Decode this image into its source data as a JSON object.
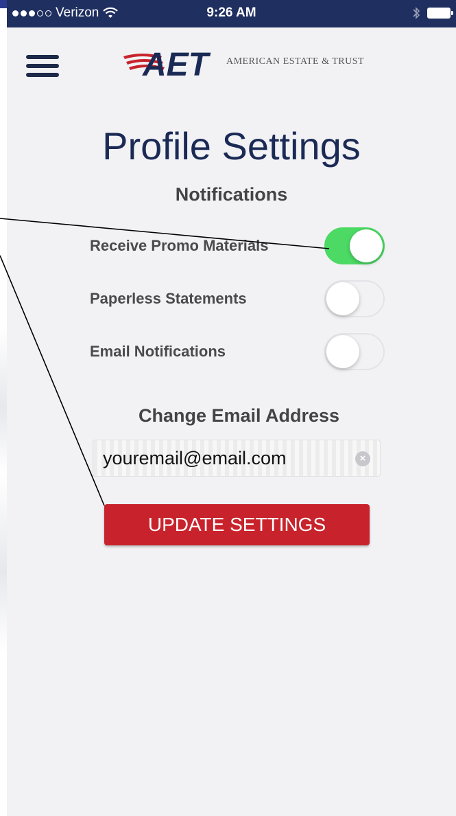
{
  "status_bar": {
    "carrier": "Verizon",
    "time": "9:26 AM",
    "signal_bars_filled": 3,
    "signal_bars_total": 5
  },
  "header": {
    "menu_icon": "hamburger-menu-icon",
    "logo_mark": "AET",
    "logo_text": "AMERICAN ESTATE & TRUST"
  },
  "page": {
    "title": "Profile Settings"
  },
  "notifications": {
    "title": "Notifications",
    "items": [
      {
        "label": "Receive Promo Materials",
        "enabled": true
      },
      {
        "label": "Paperless Statements",
        "enabled": false
      },
      {
        "label": "Email Notifications",
        "enabled": false
      }
    ]
  },
  "email": {
    "title": "Change Email Address",
    "value": "youremail@email.com",
    "clear_icon": "clear-x-icon"
  },
  "actions": {
    "update_label": "UPDATE SETTINGS"
  },
  "colors": {
    "status_bar": "#1f2f5f",
    "title_navy": "#1b2a55",
    "toggle_on": "#4cd964",
    "button_red": "#c8232c",
    "background": "#f2f2f5"
  }
}
